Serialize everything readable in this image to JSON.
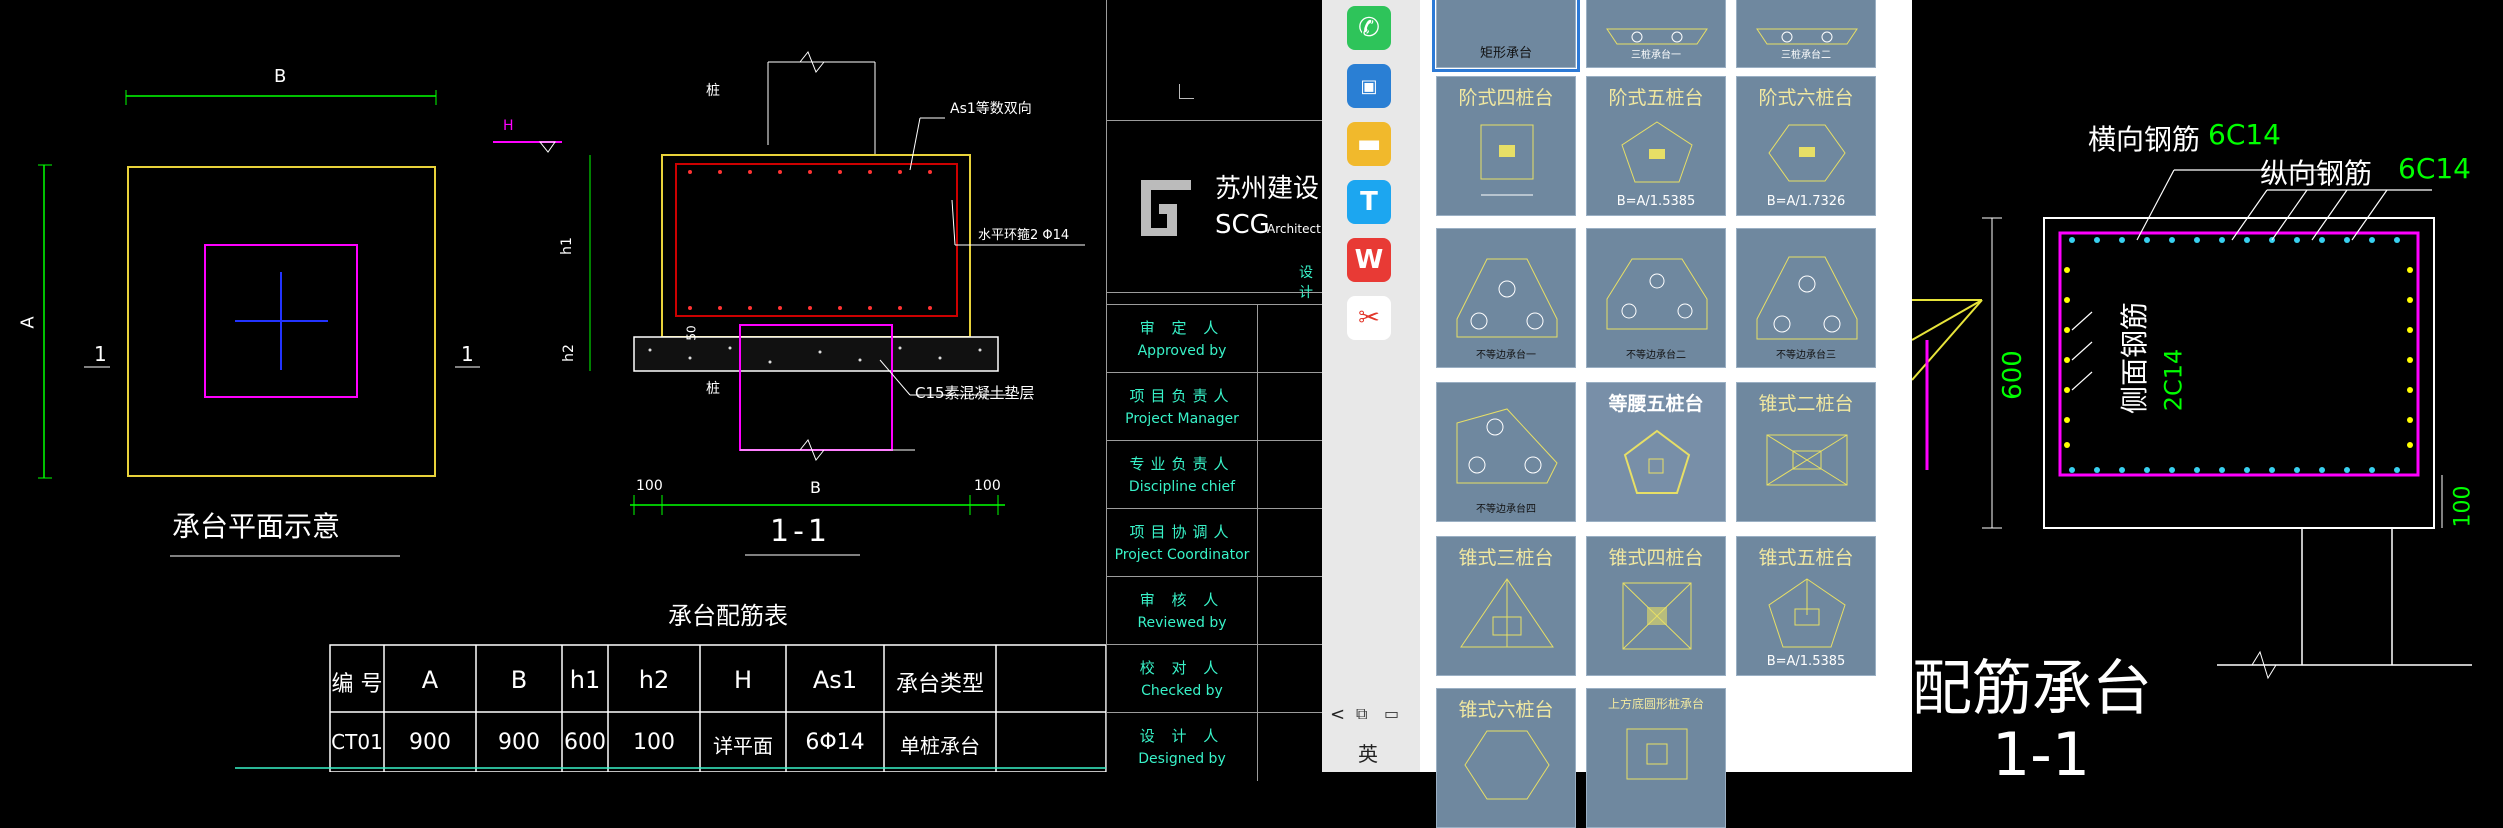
{
  "plan": {
    "dim_b": "B",
    "dim_a": "A",
    "section_mark_left": "1",
    "section_mark_right": "1",
    "caption": "承台平面示意"
  },
  "section": {
    "label_pile_top": "桩",
    "label_pile_bottom": "桩",
    "label_h": "H",
    "label_h1": "h1",
    "label_h2": "h2",
    "label_as1": "As1等数双向",
    "label_side_bar": "水平环箍2 Φ14",
    "label_c15": "C15素混凝土垫层",
    "dim_100_left": "100",
    "dim_b": "B",
    "dim_100_right": "100",
    "label_50": "50",
    "title": "1-1"
  },
  "rebar_table": {
    "title": "承台配筋表",
    "headers": [
      "编 号",
      "A",
      "B",
      "h1",
      "h2",
      "H",
      "As1",
      "承台类型"
    ],
    "row": [
      "CT01",
      "900",
      "900",
      "600",
      "100",
      "详平面",
      "6Φ14",
      "单桩承台"
    ]
  },
  "title_block": {
    "logo_cn": "苏州建设",
    "logo_en": "SCG",
    "logo_en_tail": "Architect",
    "design_note": "设计",
    "rows": [
      {
        "cn": "审 定 人",
        "en": "Approved by"
      },
      {
        "cn": "项目负责人",
        "en": "Project Manager"
      },
      {
        "cn": "专业负责人",
        "en": "Discipline chief"
      },
      {
        "cn": "项目协调人",
        "en": "Project Coordinator"
      },
      {
        "cn": "审 核 人",
        "en": "Reviewed by"
      },
      {
        "cn": "校 对 人",
        "en": "Checked by"
      },
      {
        "cn": "设 计 人",
        "en": "Designed by"
      }
    ]
  },
  "taskbar": {
    "icons": [
      "wechat-icon",
      "app-blue-icon",
      "file-explorer-icon",
      "t-app-icon",
      "wps-icon",
      "snip-tool-icon"
    ],
    "tray_chevron": "<",
    "ime_label": "英"
  },
  "gallery": {
    "top_row": [
      "矩形承台",
      "三桩承台一",
      "三桩承台二"
    ],
    "tiles": [
      {
        "title": "阶式四桩台",
        "sub": ""
      },
      {
        "title": "阶式五桩台",
        "sub": "B=A/1.5385"
      },
      {
        "title": "阶式六桩台",
        "sub": "B=A/1.7326"
      },
      {
        "title": "",
        "sub": "不等边承台一"
      },
      {
        "title": "",
        "sub": "不等边承台二"
      },
      {
        "title": "",
        "sub": "不等边承台三"
      },
      {
        "title": "",
        "sub": "不等边承台四"
      },
      {
        "title": "等腰五桩台",
        "sub": ""
      },
      {
        "title": "锥式二桩台",
        "sub": ""
      },
      {
        "title": "锥式三桩台",
        "sub": ""
      },
      {
        "title": "锥式四桩台",
        "sub": ""
      },
      {
        "title": "锥式五桩台",
        "sub": "B=A/1.5385"
      },
      {
        "title": "锥式六桩台",
        "sub": ""
      },
      {
        "title": "上方底圆形桩承台",
        "sub": ""
      }
    ]
  },
  "right_detail": {
    "label_transverse": "横向钢筋",
    "label_transverse_val": "6C14",
    "label_longitudinal": "纵向钢筋",
    "label_longitudinal_val": "6C14",
    "label_side": "侧面钢筋",
    "label_side_val": "2C14",
    "dim_600": "600",
    "dim_100": "100",
    "title": "配筋承台",
    "section": "1-1"
  },
  "colors": {
    "cad_bg": "#000000",
    "yellow": "#ffff00",
    "green": "#00ff00",
    "magenta": "#ff00ff",
    "cyan_text": "#38f2c8",
    "tile_bg": "#6f889f"
  }
}
